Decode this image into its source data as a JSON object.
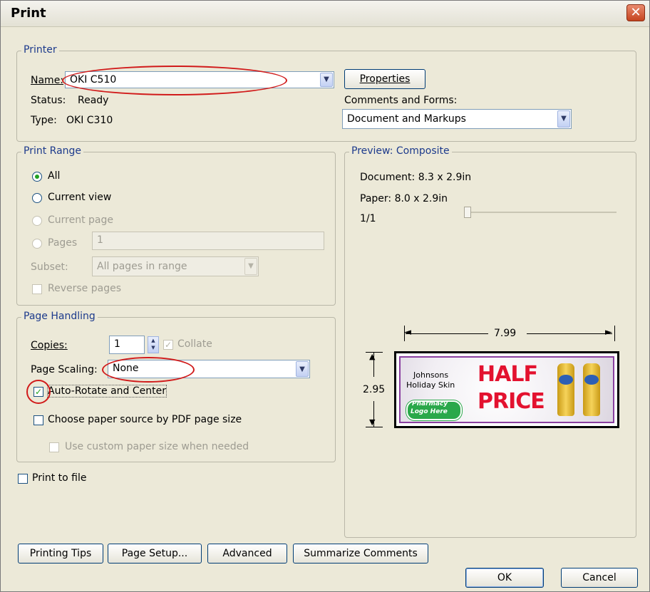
{
  "window": {
    "title": "Print",
    "close_glyph": "✕"
  },
  "printer": {
    "group_label": "Printer",
    "name_label": "Name:",
    "name_value": "OKI C510",
    "status_label": "Status:",
    "status_value": "Ready",
    "type_label": "Type:",
    "type_value": "OKI C310",
    "properties_button": "Properties",
    "comments_label": "Comments and Forms:",
    "comments_value": "Document and Markups"
  },
  "print_range": {
    "group_label": "Print Range",
    "all": "All",
    "current_view": "Current view",
    "current_page": "Current page",
    "pages": "Pages",
    "pages_value": "1",
    "subset_label": "Subset:",
    "subset_value": "All pages in range",
    "reverse_pages": "Reverse pages"
  },
  "page_handling": {
    "group_label": "Page Handling",
    "copies_label": "Copies:",
    "copies_value": "1",
    "collate": "Collate",
    "scaling_label": "Page Scaling:",
    "scaling_value": "None",
    "auto_rotate": "Auto-Rotate and Center",
    "choose_source": "Choose paper source by PDF page size",
    "custom_size": "Use custom paper size when needed"
  },
  "print_to_file": "Print to file",
  "preview": {
    "group_label": "Preview: Composite",
    "document": "Document: 8.3 x 2.9in",
    "paper": "Paper: 8.0 x 2.9in",
    "page_counter": "1/1",
    "width_dim": "7.99",
    "height_dim": "2.95",
    "ad": {
      "brand_line1": "Johnsons",
      "brand_line2": "Holiday Skin",
      "headline1": "HALF",
      "headline2": "PRICE",
      "logo_line1": "Pharmacy",
      "logo_line2": "Logo Here",
      "headline_color": "#e3122f",
      "logo_color": "#2aa84a"
    }
  },
  "buttons": {
    "printing_tips": "Printing Tips",
    "page_setup": "Page Setup...",
    "advanced": "Advanced",
    "summarize": "Summarize Comments",
    "ok": "OK",
    "cancel": "Cancel"
  },
  "colors": {
    "annotation": "#d11b1b",
    "group_label": "#1c3a8c",
    "window_bg": "#ece9d8"
  }
}
